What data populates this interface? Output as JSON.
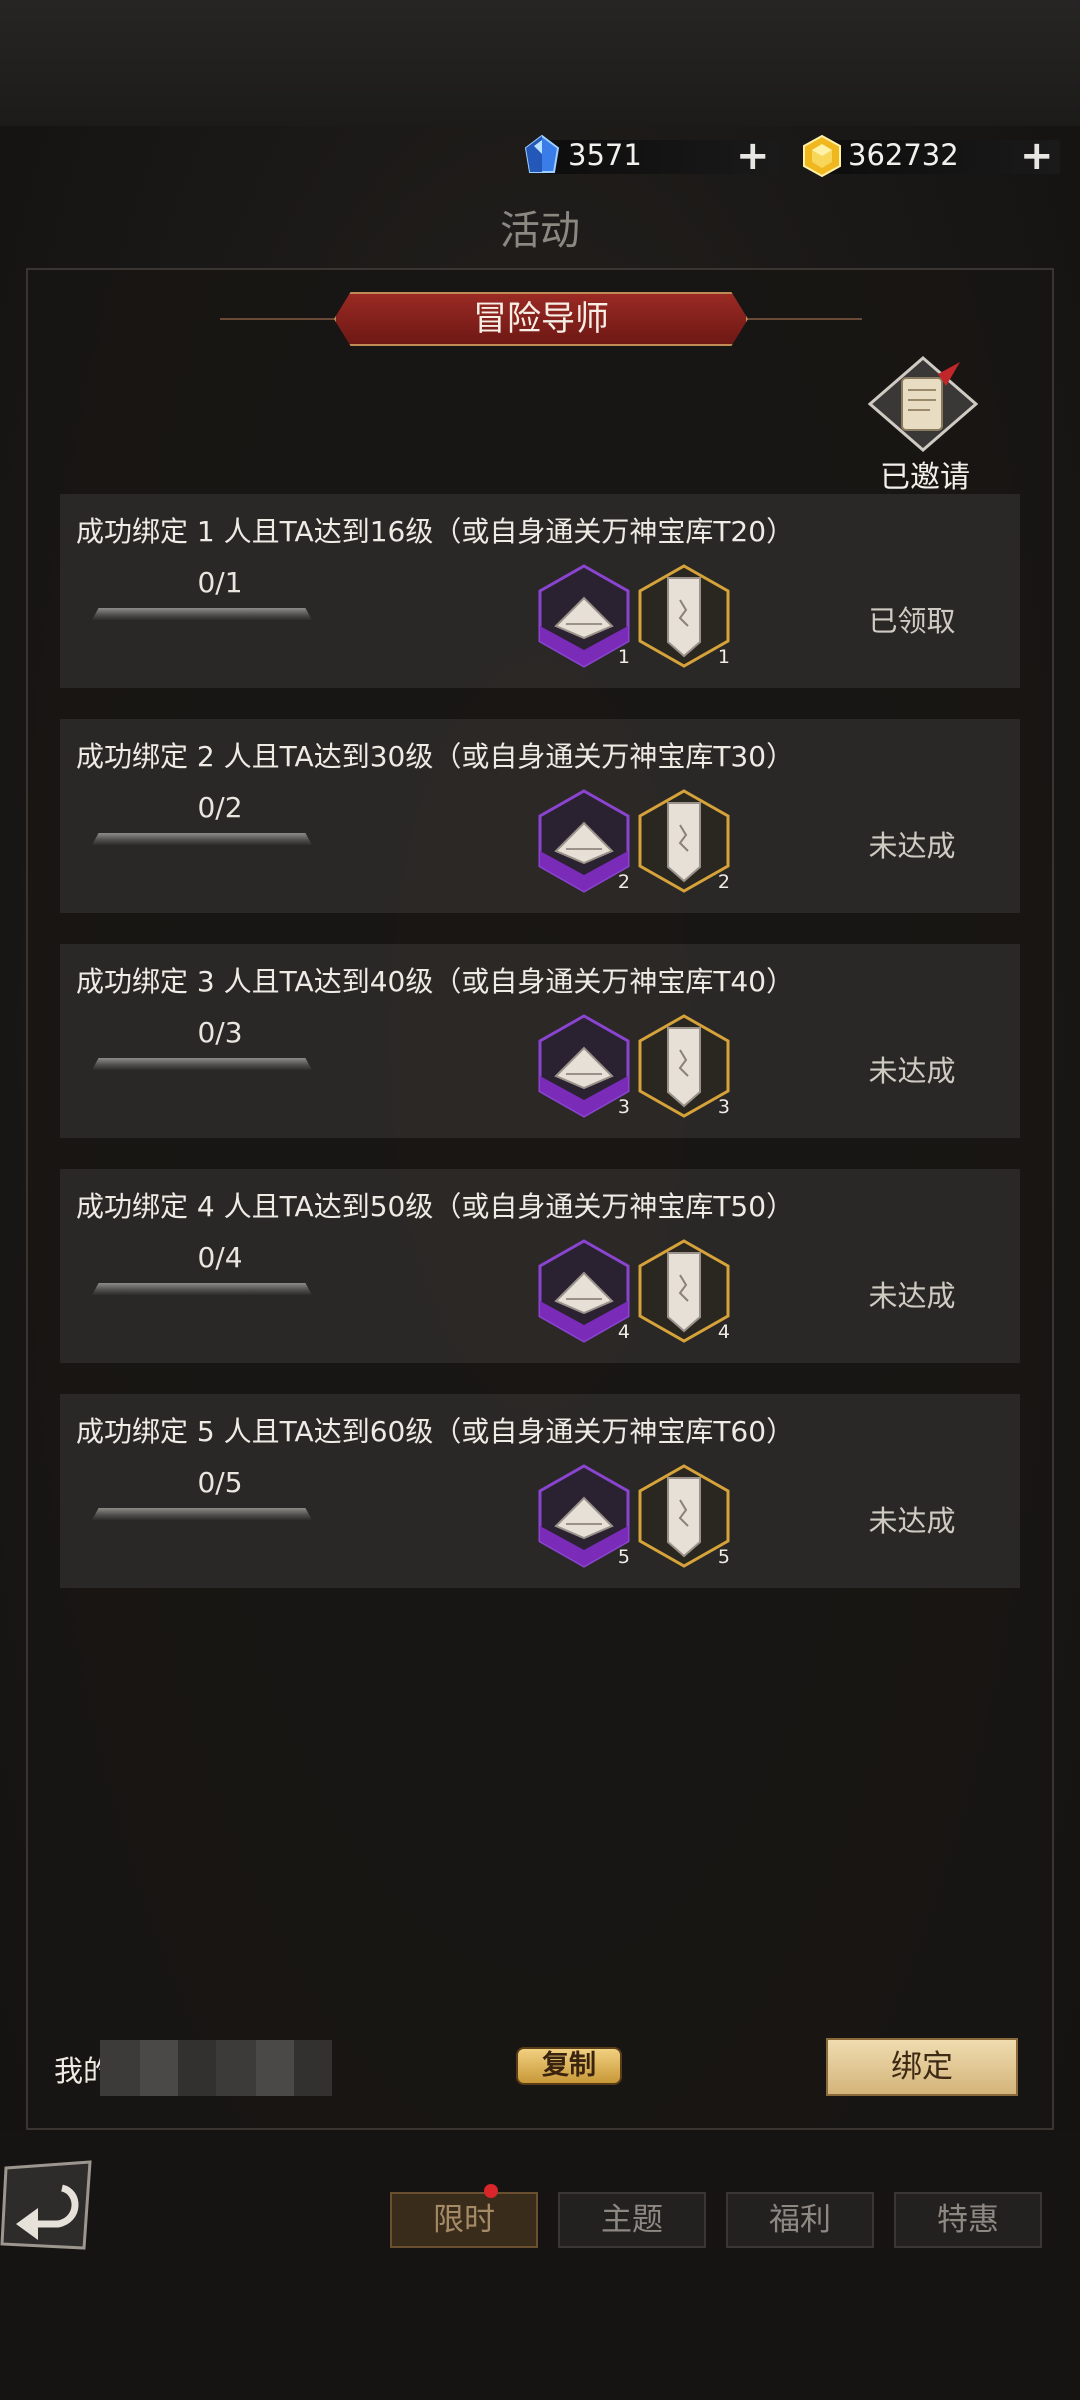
{
  "currency": {
    "gems": "3571",
    "gold": "362732",
    "plus_symbol": "+",
    "gem_icon": "blue-crystal-icon",
    "gold_icon": "gold-gem-icon"
  },
  "page_title": "活动",
  "banner": {
    "title": "冒险导师"
  },
  "invite": {
    "label": "已邀请",
    "icon": "scroll-quill-icon"
  },
  "tasks": [
    {
      "title": "成功绑定 1 人且TA达到16级（或自身通关万神宝库T20）",
      "progress_text": "0/1",
      "progress": 0,
      "reward_1_qty": "1",
      "reward_2_qty": "1",
      "status": "已领取"
    },
    {
      "title": "成功绑定 2 人且TA达到30级（或自身通关万神宝库T30）",
      "progress_text": "0/2",
      "progress": 0,
      "reward_1_qty": "2",
      "reward_2_qty": "2",
      "status": "未达成"
    },
    {
      "title": "成功绑定 3 人且TA达到40级（或自身通关万神宝库T40）",
      "progress_text": "0/3",
      "progress": 0,
      "reward_1_qty": "3",
      "reward_2_qty": "3",
      "status": "未达成"
    },
    {
      "title": "成功绑定 4 人且TA达到50级（或自身通关万神宝库T50）",
      "progress_text": "0/4",
      "progress": 0,
      "reward_1_qty": "4",
      "reward_2_qty": "4",
      "status": "未达成"
    },
    {
      "title": "成功绑定 5 人且TA达到60级（或自身通关万神宝库T60）",
      "progress_text": "0/5",
      "progress": 0,
      "reward_1_qty": "5",
      "reward_2_qty": "5",
      "status": "未达成"
    }
  ],
  "footer": {
    "my_label": "我的",
    "copy_label": "复制",
    "bind_label": "绑定"
  },
  "tabs": [
    {
      "label": "限时",
      "active": true,
      "has_dot": true
    },
    {
      "label": "主题",
      "active": false
    },
    {
      "label": "福利",
      "active": false
    },
    {
      "label": "特惠",
      "active": false
    }
  ],
  "colors": {
    "accent_gold": "#d9b35a",
    "banner_red": "#9a2a24",
    "reward_purple": "#7a2bb8",
    "reward_gold": "#d6a23a",
    "notification_red": "#d8262a"
  }
}
